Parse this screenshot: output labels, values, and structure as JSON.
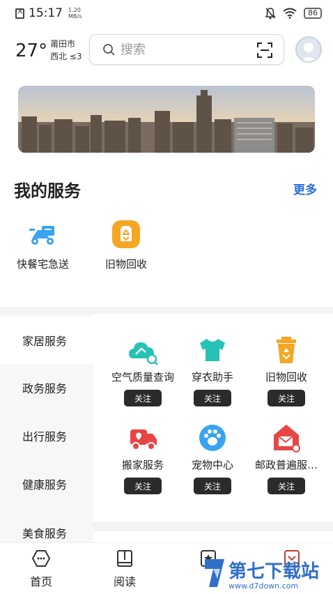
{
  "status_bar": {
    "time": "15:17",
    "speed_value": "1.20",
    "speed_unit": "MB/s",
    "battery": "86"
  },
  "header": {
    "temperature": "27°",
    "city": "莆田市",
    "wind": "西北 ≤3"
  },
  "search": {
    "placeholder": "搜索"
  },
  "my_services": {
    "title": "我的服务",
    "more_label": "更多",
    "items": [
      {
        "label": "快餐宅急送",
        "icon": "delivery-scooter-icon"
      },
      {
        "label": "旧物回收",
        "icon": "recycle-badge-icon"
      }
    ]
  },
  "categories": [
    {
      "label": "家居服务"
    },
    {
      "label": "政务服务"
    },
    {
      "label": "出行服务"
    },
    {
      "label": "健康服务"
    },
    {
      "label": "美食服务"
    }
  ],
  "home_services": [
    {
      "label": "空气质量查询",
      "button": "关注",
      "icon": "air-quality-cloud-icon"
    },
    {
      "label": "穿衣助手",
      "button": "关注",
      "icon": "tshirt-icon"
    },
    {
      "label": "旧物回收",
      "button": "关注",
      "icon": "recycle-bin-icon"
    },
    {
      "label": "搬家服务",
      "button": "关注",
      "icon": "moving-truck-icon"
    },
    {
      "label": "宠物中心",
      "button": "关注",
      "icon": "paw-icon"
    },
    {
      "label": "邮政普遍服…",
      "button": "关注",
      "icon": "post-mail-icon"
    }
  ],
  "tabs": [
    {
      "label": "首页",
      "icon": "home-chat-icon"
    },
    {
      "label": "阅读",
      "icon": "book-icon"
    }
  ],
  "watermark": {
    "text": "第七下载站",
    "url": "www.d7down.com"
  },
  "colors": {
    "accent_blue": "#2a6fd8",
    "teal": "#27c2b5",
    "orange": "#f5a623",
    "red": "#e84545",
    "sky": "#3aa3ef",
    "dark_button": "#2b2b2b"
  }
}
